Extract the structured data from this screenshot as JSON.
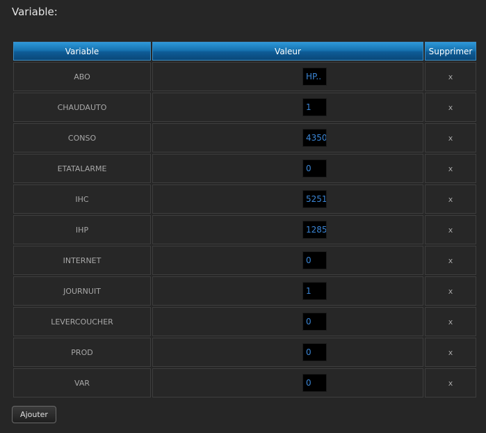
{
  "page": {
    "title": "Variable:"
  },
  "table": {
    "headers": {
      "variable": "Variable",
      "valeur": "Valeur",
      "supprimer": "Supprimer"
    },
    "delete_label": "x",
    "rows": [
      {
        "name": "ABO",
        "value": "HP.."
      },
      {
        "name": "CHAUDAUTO",
        "value": "1"
      },
      {
        "name": "CONSO",
        "value": "4350"
      },
      {
        "name": "ETATALARME",
        "value": "0"
      },
      {
        "name": "IHC",
        "value": "5251"
      },
      {
        "name": "IHP",
        "value": "1285"
      },
      {
        "name": "INTERNET",
        "value": "0"
      },
      {
        "name": "JOURNUIT",
        "value": "1"
      },
      {
        "name": "LEVERCOUCHER",
        "value": "0"
      },
      {
        "name": "PROD",
        "value": "0"
      },
      {
        "name": "VAR",
        "value": "0"
      }
    ]
  },
  "actions": {
    "add_label": "Ajouter"
  },
  "colors": {
    "background": "#262626",
    "header_blue": "#1673b1",
    "value_text": "#3b86d6"
  }
}
